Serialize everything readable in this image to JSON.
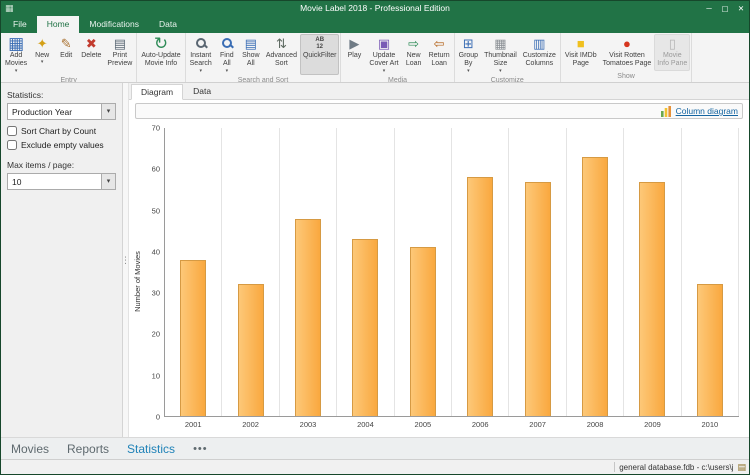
{
  "window": {
    "title": "Movie Label 2018 - Professional Edition"
  },
  "icons": {
    "app": "▦",
    "minimize": "─",
    "maximize": "▢",
    "close": "✕",
    "dropdown": "▾",
    "splitter": "⋮",
    "status_file": "▤"
  },
  "ribbon_tabs": [
    {
      "label": "File",
      "active": false
    },
    {
      "label": "Home",
      "active": true
    },
    {
      "label": "Modifications",
      "active": false
    },
    {
      "label": "Data",
      "active": false
    }
  ],
  "ribbon": {
    "groups": [
      {
        "label": "Entry",
        "buttons": [
          {
            "name": "add-movies",
            "label": "Add\nMovies",
            "icon": "▦",
            "color": "#3a6db4",
            "big": true,
            "arrow": true
          },
          {
            "name": "new",
            "label": "New",
            "icon": "✦",
            "color": "#d4a017",
            "arrow": true
          },
          {
            "name": "edit",
            "label": "Edit",
            "icon": "✎",
            "color": "#a86f2d"
          },
          {
            "name": "delete",
            "label": "Delete",
            "icon": "✖",
            "color": "#c23b2e"
          },
          {
            "name": "print-preview",
            "label": "Print\nPreview",
            "icon": "▤",
            "color": "#5e6b77"
          }
        ]
      },
      {
        "label": "",
        "buttons": [
          {
            "name": "auto-update-movie-info",
            "label": "Auto-Update\nMovie Info",
            "icon": "↻",
            "color": "#2e8b57",
            "big": true
          }
        ]
      },
      {
        "label": "Search and Sort",
        "buttons": [
          {
            "name": "instant-search",
            "label": "Instant\nSearch",
            "icon": "search",
            "color": "#5a6672",
            "arrow": true
          },
          {
            "name": "find-all",
            "label": "Find\nAll",
            "icon": "search",
            "color": "#3a6db4",
            "arrow": true
          },
          {
            "name": "show-all",
            "label": "Show\nAll",
            "icon": "▤",
            "color": "#3a6db4"
          },
          {
            "name": "advanced-sort",
            "label": "Advanced\nSort",
            "icon": "⇅",
            "color": "#5f6b62"
          },
          {
            "name": "quickfilter",
            "label": "QuickFilter",
            "icon_text": "AB\n12",
            "color": "#444444",
            "pressed": true
          }
        ]
      },
      {
        "label": "Media",
        "buttons": [
          {
            "name": "play",
            "label": "Play",
            "icon": "▶",
            "color": "#6f7b85"
          },
          {
            "name": "update-cover-art",
            "label": "Update\nCover Art",
            "icon": "▣",
            "color": "#7a5ab5",
            "arrow": true
          },
          {
            "name": "new-loan",
            "label": "New\nLoan",
            "icon": "⇨",
            "color": "#2e8b57"
          },
          {
            "name": "return-loan",
            "label": "Return\nLoan",
            "icon": "⇦",
            "color": "#b5651d"
          }
        ]
      },
      {
        "label": "Customize",
        "buttons": [
          {
            "name": "group-by",
            "label": "Group\nBy",
            "icon": "⊞",
            "color": "#3a6db4",
            "arrow": true
          },
          {
            "name": "thumbnail-size",
            "label": "Thumbnail\nSize",
            "icon": "▦",
            "color": "#8a8f94",
            "arrow": true
          },
          {
            "name": "customize-columns",
            "label": "Customize\nColumns",
            "icon": "▥",
            "color": "#3a6db4"
          }
        ]
      },
      {
        "label": "Show",
        "buttons": [
          {
            "name": "visit-imdb-page",
            "label": "Visit IMDb\nPage",
            "icon": "■",
            "color": "#f0c01e"
          },
          {
            "name": "visit-rotten-tomatoes-page",
            "label": "Visit Rotten\nTomatoes Page",
            "icon": "●",
            "color": "#d6361f"
          },
          {
            "name": "movie-info-pane",
            "label": "Movie\nInfo Pane",
            "icon": "▯",
            "color": "#777777",
            "pressed": true,
            "disabled": true
          }
        ]
      }
    ]
  },
  "sidebar": {
    "statistics_label": "Statistics:",
    "statistic_value": "Production Year",
    "checkboxes": [
      {
        "label": "Sort Chart by Count",
        "checked": false
      },
      {
        "label": "Exclude empty values",
        "checked": false
      }
    ],
    "max_items_label": "Max items / page:",
    "max_items_value": "10"
  },
  "main": {
    "doc_tabs": [
      {
        "label": "Diagram",
        "active": true
      },
      {
        "label": "Data",
        "active": false
      }
    ],
    "column_diagram_label": "Column diagram"
  },
  "chart_data": {
    "type": "bar",
    "categories": [
      "2001",
      "2002",
      "2003",
      "2004",
      "2005",
      "2006",
      "2007",
      "2008",
      "2009",
      "2010"
    ],
    "values": [
      38,
      32,
      48,
      43,
      41,
      58,
      57,
      63,
      57,
      32
    ],
    "title": "",
    "xlabel": "",
    "ylabel": "Number of Movies",
    "ylim": [
      0,
      70
    ],
    "yticks": [
      0,
      10,
      20,
      30,
      40,
      50,
      60,
      70
    ],
    "bar_color": "#FBB65A",
    "bar_border": "#D69A43",
    "grid": "vertical",
    "legend": "none"
  },
  "bottom_nav": {
    "items": [
      {
        "label": "Movies",
        "active": false
      },
      {
        "label": "Reports",
        "active": false
      },
      {
        "label": "Statistics",
        "active": true
      }
    ],
    "more": "•••"
  },
  "status": {
    "right_text": "general database.fdb - c:\\users\\j"
  }
}
